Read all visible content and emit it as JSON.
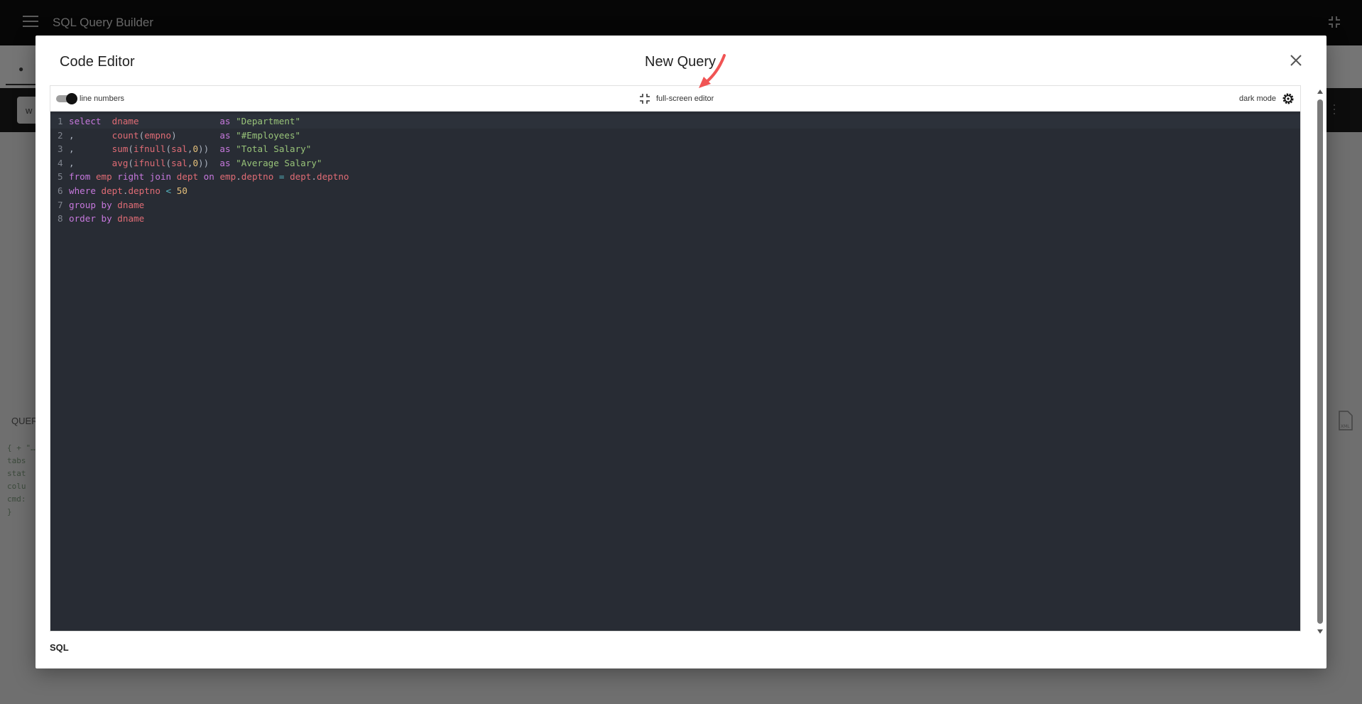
{
  "app": {
    "title": "SQL Query Builder"
  },
  "background": {
    "input_value": "w",
    "query_label": "QUER",
    "json_preview": [
      "{ + \"…",
      "  tabs",
      "  stat",
      "  colu",
      "  cmd:",
      "}"
    ]
  },
  "modal": {
    "title_left": "Code Editor",
    "title_center": "New Query",
    "footer_label": "SQL"
  },
  "editor_toolbar": {
    "line_numbers_label": "line numbers",
    "line_numbers_on": true,
    "fullscreen_label": "full-screen editor",
    "dark_mode_label": "dark mode"
  },
  "code": {
    "language": "SQL",
    "lines": [
      "select  dname               as \"Department\"",
      ",       count(empno)        as \"#Employees\"",
      ",       sum(ifnull(sal,0))  as \"Total Salary\"",
      ",       avg(ifnull(sal,0))  as \"Average Salary\"",
      "from emp right join dept on emp.deptno = dept.deptno",
      "where dept.deptno < 50",
      "group by dname",
      "order by dname"
    ]
  },
  "colors": {
    "editor_bg": "#282c34",
    "keyword": "#c678dd",
    "identifier": "#e06c75",
    "string": "#98c379",
    "number": "#e5c07b",
    "annotation_arrow": "#f05454"
  },
  "icons": {
    "menu": "menu-icon",
    "exit_fullscreen": "exit-fullscreen-icon",
    "close": "close-icon",
    "fullscreen": "fullscreen-exit-icon",
    "dark_mode": "gear-icon",
    "xml": "xml-file-icon"
  }
}
